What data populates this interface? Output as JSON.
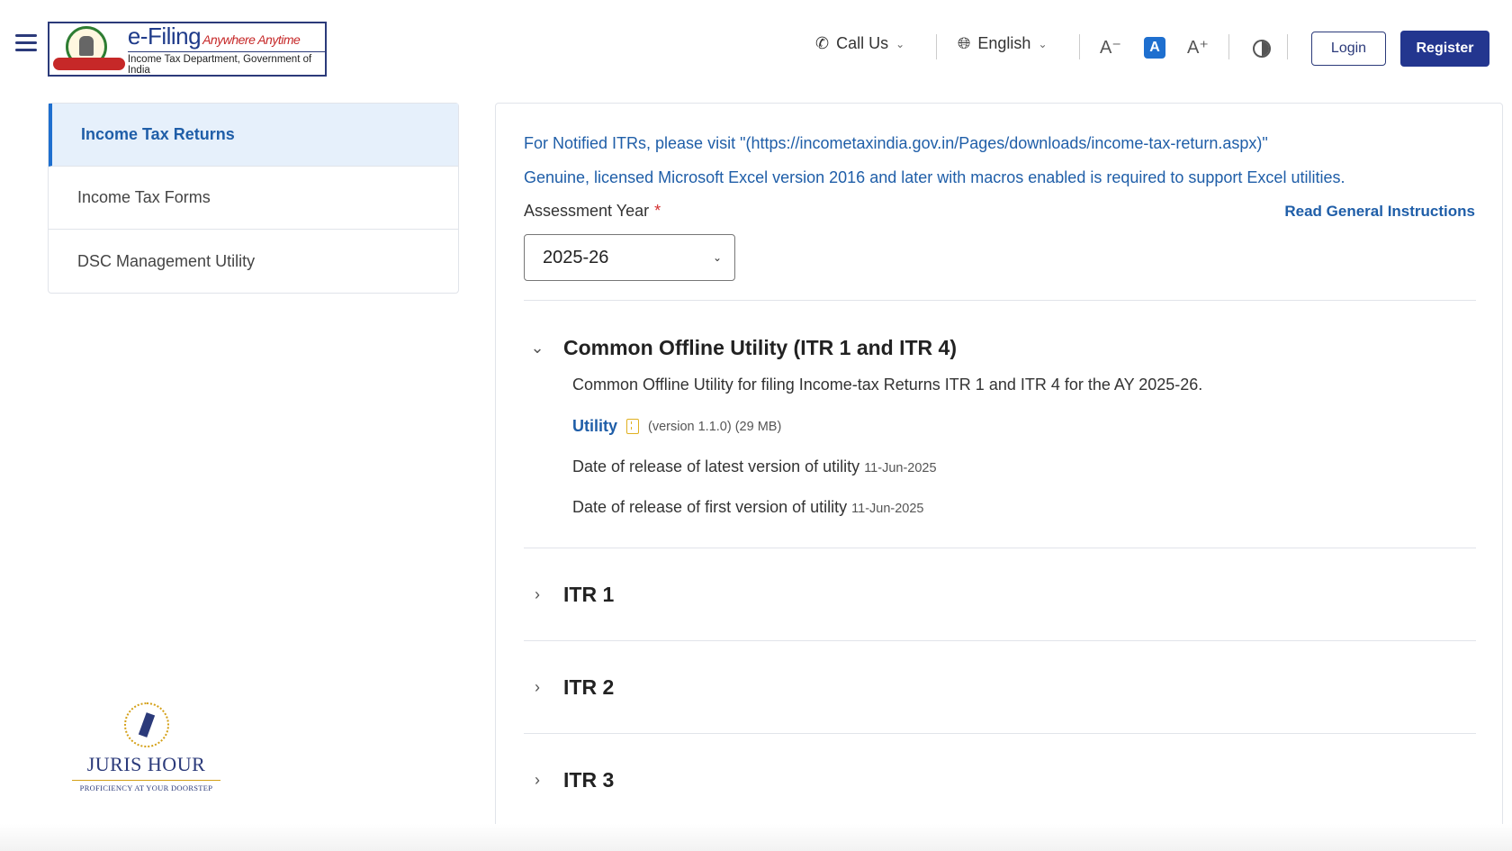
{
  "header": {
    "logo_title": "e-Filing",
    "logo_tagline": "Anywhere Anytime",
    "logo_subtitle": "Income Tax Department, Government of India",
    "call_us": "Call Us",
    "language": "English",
    "font_decrease": "A⁻",
    "font_default": "A",
    "font_increase": "A⁺",
    "login": "Login",
    "register": "Register"
  },
  "sidebar": {
    "items": [
      {
        "label": "Income Tax Returns",
        "active": true
      },
      {
        "label": "Income Tax Forms",
        "active": false
      },
      {
        "label": "DSC Management Utility",
        "active": false
      }
    ]
  },
  "watermark": {
    "name": "JURIS HOUR",
    "tagline": "PROFICIENCY AT YOUR DOORSTEP"
  },
  "main": {
    "notice1": "For Notified ITRs, please visit \"(https://incometaxindia.gov.in/Pages/downloads/income-tax-return.aspx)\"",
    "notice2": "Genuine, licensed Microsoft Excel version 2016 and later with macros enabled is required to support Excel utilities.",
    "ay_label": "Assessment Year",
    "ay_required": "*",
    "ay_value": "2025-26",
    "read_instructions": "Read General Instructions",
    "sections": [
      {
        "title": "Common Offline Utility (ITR 1 and ITR 4)",
        "expanded": true,
        "description": "Common Offline Utility for filing Income-tax Returns ITR 1 and ITR 4 for the AY 2025-26.",
        "utility_link": "Utility",
        "utility_meta": "(version 1.1.0) (29 MB)",
        "latest_label": "Date of release of latest version of utility",
        "latest_date": "11-Jun-2025",
        "first_label": "Date of release of first version of utility",
        "first_date": "11-Jun-2025"
      },
      {
        "title": "ITR 1",
        "expanded": false
      },
      {
        "title": "ITR 2",
        "expanded": false
      },
      {
        "title": "ITR 3",
        "expanded": false
      }
    ]
  },
  "colors": {
    "brand": "#23368f",
    "link": "#1f5ea8",
    "active_bg": "#e6f0fb",
    "required": "#d32f2f"
  },
  "icons": {
    "menu": "hamburger-icon",
    "phone": "phone-icon",
    "globe": "globe-icon",
    "contrast": "contrast-icon",
    "expand": "chevron-down-icon",
    "collapse": "chevron-right-icon",
    "zip": "zip-file-icon"
  }
}
